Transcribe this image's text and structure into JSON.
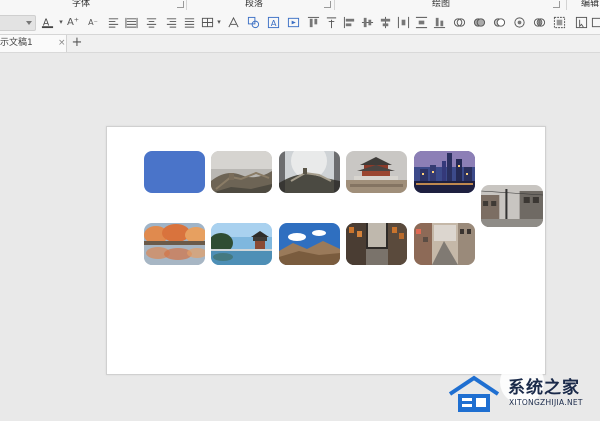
{
  "ribbon": {
    "groups": [
      {
        "label": "字体"
      },
      {
        "label": "段落"
      },
      {
        "label": "绘图"
      },
      {
        "label": "编辑"
      }
    ],
    "font_color_glyph": "A",
    "grow_font_glyph": "A⁺",
    "shrink_font_glyph": "A⁻"
  },
  "tabs": {
    "doc_title": "示文稿1",
    "close_glyph": "×",
    "new_tab_glyph": "+"
  },
  "slide": {
    "tiles": [
      {
        "name": "blue-shape",
        "kind": "solid",
        "color": "#4a74c9"
      },
      {
        "name": "great-wall-misty-photo",
        "kind": "photo"
      },
      {
        "name": "great-wall-sky-photo",
        "kind": "photo"
      },
      {
        "name": "temple-of-heaven-photo",
        "kind": "photo"
      },
      {
        "name": "city-night-skyline-photo",
        "kind": "photo"
      },
      {
        "name": "old-street-photo-dragged",
        "kind": "photo"
      },
      {
        "name": "autumn-lake-photo",
        "kind": "photo"
      },
      {
        "name": "pagoda-lake-photo",
        "kind": "photo"
      },
      {
        "name": "mountain-blue-sky-photo",
        "kind": "photo"
      },
      {
        "name": "lantern-street-photo",
        "kind": "photo"
      },
      {
        "name": "city-street-photo",
        "kind": "photo"
      }
    ]
  },
  "watermark": {
    "title": "系统之家",
    "subtitle": "XITONGZHIJIA.NET"
  },
  "colors": {
    "accent_blue": "#4a74c9",
    "watermark_blue": "#1f6fd1"
  }
}
